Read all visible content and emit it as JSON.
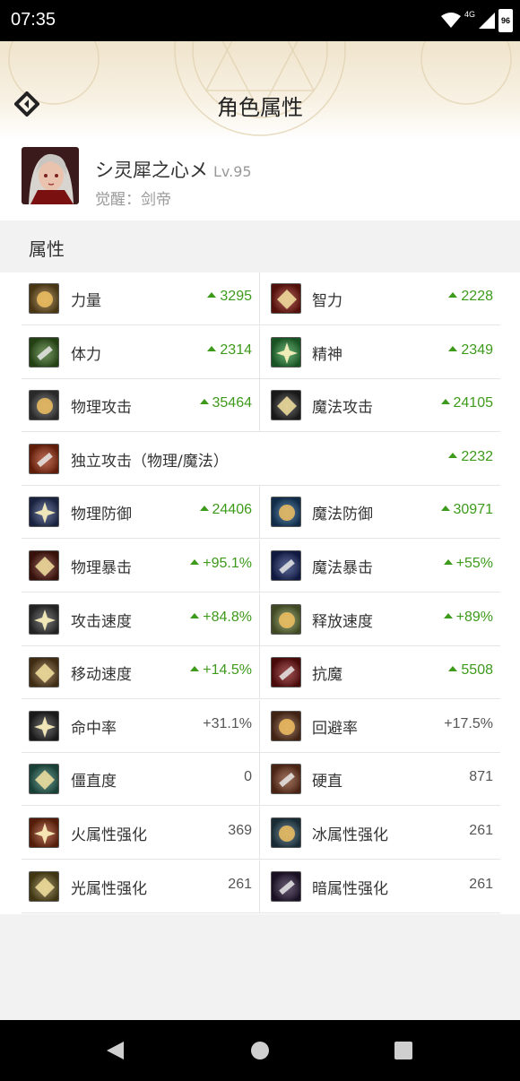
{
  "status_bar": {
    "time": "07:35",
    "network": "4G",
    "battery": "96"
  },
  "header": {
    "title": "角色属性"
  },
  "profile": {
    "name": "シ灵犀之心メ",
    "level": "Lv.95",
    "awakening": "觉醒：剑帝"
  },
  "section": {
    "title": "属性"
  },
  "stats": [
    {
      "label": "力量",
      "value": "3295",
      "up": true,
      "icon": "strength-icon",
      "color": "#7a5a20"
    },
    {
      "label": "智力",
      "value": "2228",
      "up": true,
      "icon": "intelligence-icon",
      "color": "#8a1a10"
    },
    {
      "label": "体力",
      "value": "2314",
      "up": true,
      "icon": "vitality-icon",
      "color": "#3a6a20"
    },
    {
      "label": "精神",
      "value": "2349",
      "up": true,
      "icon": "spirit-icon",
      "color": "#2a8a3a"
    },
    {
      "label": "物理攻击",
      "value": "35464",
      "up": true,
      "icon": "physical-attack-icon",
      "color": "#444444"
    },
    {
      "label": "魔法攻击",
      "value": "24105",
      "up": true,
      "icon": "magic-attack-icon",
      "color": "#2a2a2a"
    },
    {
      "label": "独立攻击（物理/魔法）",
      "value": "2232",
      "up": true,
      "icon": "independent-attack-icon",
      "color": "#a03010"
    },
    {
      "label": "物理防御",
      "value": "24406",
      "up": true,
      "icon": "physical-defense-icon",
      "color": "#2a3a6a"
    },
    {
      "label": "魔法防御",
      "value": "30971",
      "up": true,
      "icon": "magic-defense-icon",
      "color": "#1a4a7a"
    },
    {
      "label": "物理暴击",
      "value": "+95.1%",
      "up": true,
      "icon": "physical-crit-icon",
      "color": "#5a1a10"
    },
    {
      "label": "魔法暴击",
      "value": "+55%",
      "up": true,
      "icon": "magic-crit-icon",
      "color": "#1a2a6a"
    },
    {
      "label": "攻击速度",
      "value": "+84.8%",
      "up": true,
      "icon": "attack-speed-icon",
      "color": "#3a3a3a"
    },
    {
      "label": "释放速度",
      "value": "+89%",
      "up": true,
      "icon": "cast-speed-icon",
      "color": "#6a7a3a"
    },
    {
      "label": "移动速度",
      "value": "+14.5%",
      "up": true,
      "icon": "move-speed-icon",
      "color": "#6a4a20"
    },
    {
      "label": "抗魔",
      "value": "5508",
      "up": true,
      "icon": "magic-resist-icon",
      "color": "#7a1010"
    },
    {
      "label": "命中率",
      "value": "+31.1%",
      "up": false,
      "icon": "hit-rate-icon",
      "color": "#2a2a2a"
    },
    {
      "label": "回避率",
      "value": "+17.5%",
      "up": false,
      "icon": "evasion-icon",
      "color": "#6a3a20"
    },
    {
      "label": "僵直度",
      "value": "0",
      "up": false,
      "icon": "stiffness-icon",
      "color": "#2a6a5a"
    },
    {
      "label": "硬直",
      "value": "871",
      "up": false,
      "icon": "hit-recovery-icon",
      "color": "#7a3a20"
    },
    {
      "label": "火属性强化",
      "value": "369",
      "up": false,
      "icon": "fire-element-icon",
      "color": "#8a3010"
    },
    {
      "label": "冰属性强化",
      "value": "261",
      "up": false,
      "icon": "ice-element-icon",
      "color": "#2a4a5a"
    },
    {
      "label": "光属性强化",
      "value": "261",
      "up": false,
      "icon": "light-element-icon",
      "color": "#6a5a20"
    },
    {
      "label": "暗属性强化",
      "value": "261",
      "up": false,
      "icon": "dark-element-icon",
      "color": "#2a1a3a"
    }
  ]
}
